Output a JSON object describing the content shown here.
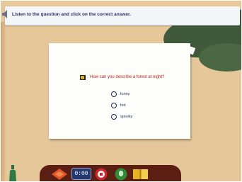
{
  "instruction": "Listen to the question and click on the correct answer.",
  "question": {
    "text": "How can you describe a forest at night?",
    "options": [
      "funny",
      "hot",
      "spooky"
    ]
  },
  "toolbar": {
    "timer_display": "0:00"
  },
  "icons": {
    "speaker_left": "speaker-icon",
    "question_audio": "audio-icon",
    "orange": "orange-arrow-icon",
    "red": "red-stop-icon",
    "green": "green-mic-icon",
    "yellow": "yellow-book-icon",
    "bottle": "bottle-icon"
  }
}
